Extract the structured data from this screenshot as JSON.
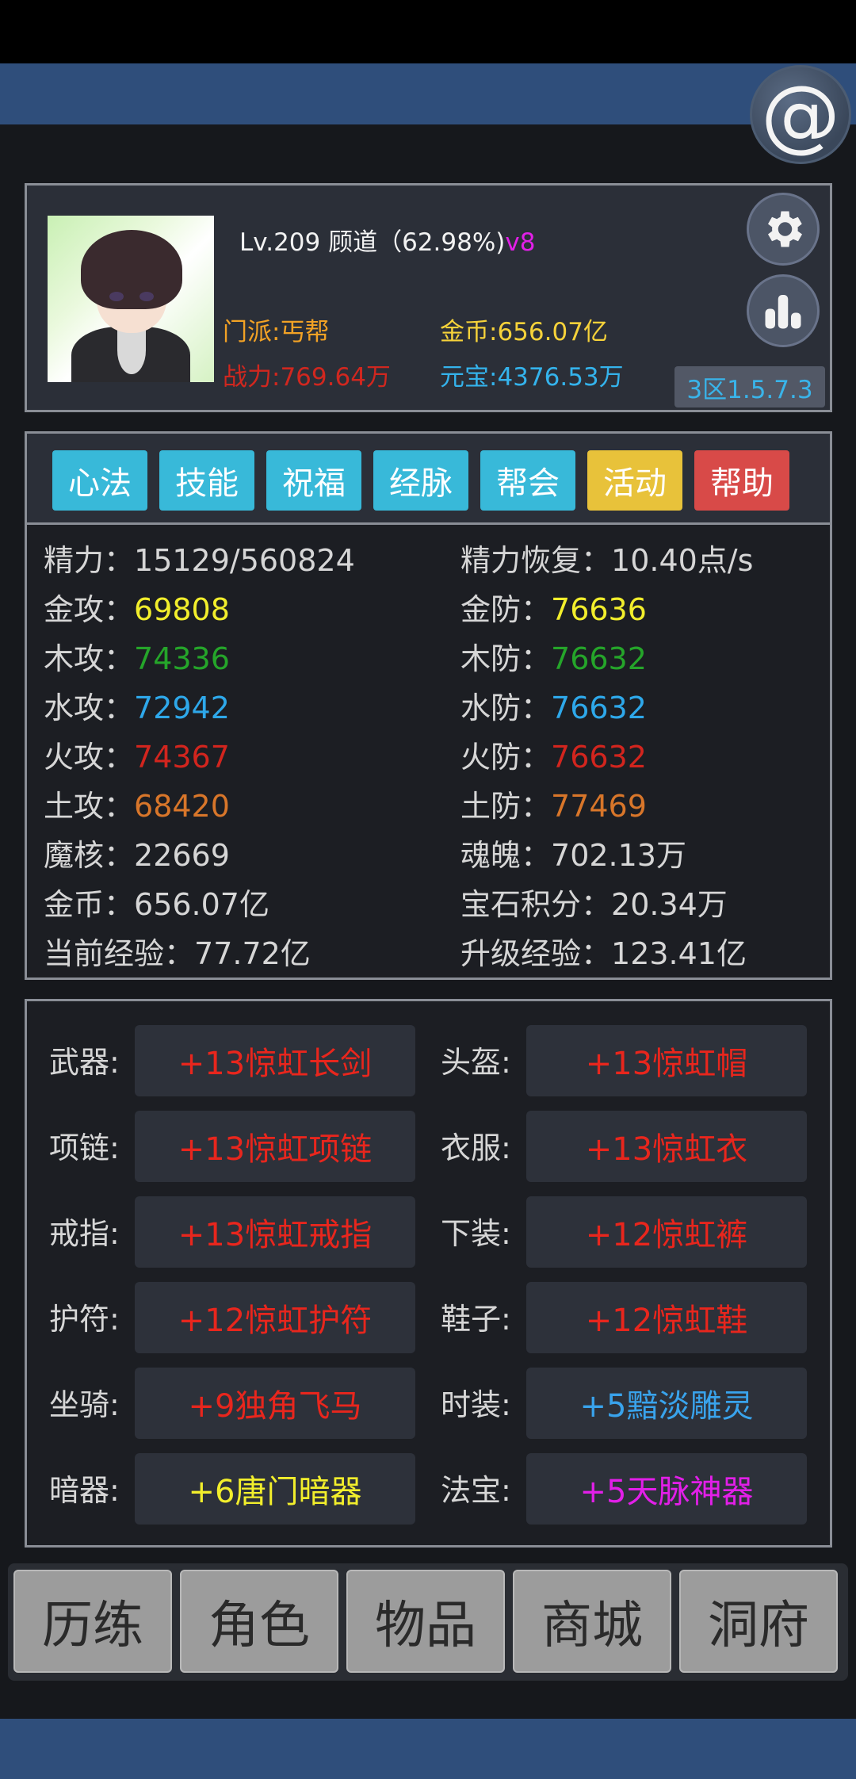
{
  "header": {
    "at_icon": "@"
  },
  "profile": {
    "level_name": "Lv.209 顾道（62.98%)",
    "vip": "v8",
    "sect": "门派:丐帮",
    "gold": "金币:656.07亿",
    "power": "战力:769.64万",
    "yuanbao": "元宝:4376.53万",
    "version": "3区1.5.7.3",
    "icons": {
      "settings": "gear-icon",
      "stats": "bar-chart-icon"
    }
  },
  "tabs": [
    {
      "label": "心法",
      "color": "#38b9d9"
    },
    {
      "label": "技能",
      "color": "#38b9d9"
    },
    {
      "label": "祝福",
      "color": "#38b9d9"
    },
    {
      "label": "经脉",
      "color": "#38b9d9"
    },
    {
      "label": "帮会",
      "color": "#38b9d9"
    },
    {
      "label": "活动",
      "color": "#e8c23a"
    },
    {
      "label": "帮助",
      "color": "#d84a48"
    }
  ],
  "stats": {
    "left": [
      {
        "label": "精力：",
        "value": "15129/560824"
      },
      {
        "label": "金攻：",
        "value": "69808"
      },
      {
        "label": "木攻：",
        "value": "74336"
      },
      {
        "label": "水攻：",
        "value": "72942"
      },
      {
        "label": "火攻：",
        "value": "74367"
      },
      {
        "label": "土攻：",
        "value": "68420"
      },
      {
        "label": "魔核：",
        "value": "22669"
      },
      {
        "label": "金币：",
        "value": "656.07亿"
      },
      {
        "label": "当前经验：",
        "value": "77.72亿"
      }
    ],
    "right": [
      {
        "label": "精力恢复：",
        "value": "10.40点/s"
      },
      {
        "label": "金防：",
        "value": "76636"
      },
      {
        "label": "木防：",
        "value": "76632"
      },
      {
        "label": "水防：",
        "value": "76632"
      },
      {
        "label": "火防：",
        "value": "76632"
      },
      {
        "label": "土防：",
        "value": "77469"
      },
      {
        "label": "魂魄：",
        "value": "702.13万"
      },
      {
        "label": "宝石积分：",
        "value": "20.34万"
      },
      {
        "label": "升级经验：",
        "value": "123.41亿"
      }
    ]
  },
  "equipment": {
    "left": [
      {
        "slot": "武器:",
        "item": "+13惊虹长剑"
      },
      {
        "slot": "项链:",
        "item": "+13惊虹项链"
      },
      {
        "slot": "戒指:",
        "item": "+13惊虹戒指"
      },
      {
        "slot": "护符:",
        "item": "+12惊虹护符"
      },
      {
        "slot": "坐骑:",
        "item": "+9独角飞马"
      },
      {
        "slot": "暗器:",
        "item": "+6唐门暗器"
      }
    ],
    "right": [
      {
        "slot": "头盔:",
        "item": "+13惊虹帽"
      },
      {
        "slot": "衣服:",
        "item": "+13惊虹衣"
      },
      {
        "slot": "下装:",
        "item": "+12惊虹裤"
      },
      {
        "slot": "鞋子:",
        "item": "+12惊虹鞋"
      },
      {
        "slot": "时装:",
        "item": "+5黯淡雕灵"
      },
      {
        "slot": "法宝:",
        "item": "+5天脉神器"
      }
    ]
  },
  "nav": [
    "历练",
    "角色",
    "物品",
    "商城",
    "洞府"
  ]
}
